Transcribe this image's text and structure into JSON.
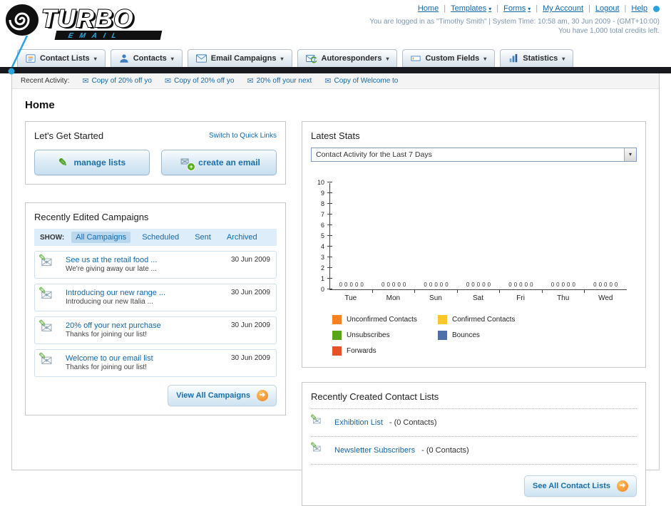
{
  "colors": {
    "accent_blue": "#2aa3dc",
    "link_blue": "#1468a8",
    "button_text_blue": "#1b6fa8",
    "orange_accent": "#f08018",
    "dark_bar": "#17191e"
  },
  "icons": {
    "chevron_down": "▾",
    "arrow_right": "➜",
    "envelope": "✉",
    "pencil": "✎",
    "plus": "+"
  },
  "header": {
    "logo_primary": "TURBO",
    "logo_secondary": "EMAIL",
    "separator": "|",
    "links": [
      {
        "label": "Home"
      },
      {
        "label": "Templates",
        "dropdown": true
      },
      {
        "label": "Forms",
        "dropdown": true
      },
      {
        "label": "My Account"
      },
      {
        "label": "Logout"
      },
      {
        "label": "Help"
      }
    ],
    "login_info": "You are logged in as \"Timothy Smith\" | System Time: 10:58 am, 30 Jun 2009 - (GMT+10:00)",
    "credits_info": "You have 1,000 total credits left."
  },
  "nav": {
    "items": [
      {
        "label": "Contact Lists"
      },
      {
        "label": "Contacts"
      },
      {
        "label": "Email Campaigns"
      },
      {
        "label": "Autoresponders"
      },
      {
        "label": "Custom Fields"
      },
      {
        "label": "Statistics"
      }
    ]
  },
  "recent_activity": {
    "label": "Recent Activity:",
    "items": [
      {
        "text": "Copy of 20% off yo"
      },
      {
        "text": "Copy of 20% off yo"
      },
      {
        "text": "20% off your next"
      },
      {
        "text": "Copy of Welcome to"
      }
    ]
  },
  "page": {
    "title": "Home"
  },
  "get_started": {
    "title": "Let's Get Started",
    "switch_link": "Switch to Quick Links",
    "manage_lists": "manage lists",
    "create_email": "create an email"
  },
  "campaigns": {
    "title": "Recently Edited Campaigns",
    "show_label": "SHOW:",
    "tabs": [
      {
        "label": "All Campaigns",
        "active": true
      },
      {
        "label": "Scheduled"
      },
      {
        "label": "Sent"
      },
      {
        "label": "Archived"
      }
    ],
    "items": [
      {
        "title": "See us at the retail food ...",
        "subtitle": "We're giving away our late ...",
        "date": "30 Jun 2009"
      },
      {
        "title": "Introducing our new range ...",
        "subtitle": "Introducing our new Italia ...",
        "date": "30 Jun 2009"
      },
      {
        "title": "20% off your next purchase",
        "subtitle": "Thanks for joining our list!",
        "date": "30 Jun 2009"
      },
      {
        "title": "Welcome to our email list",
        "subtitle": "Thanks for joining our list!",
        "date": "30 Jun 2009"
      }
    ],
    "view_all_button": "View All Campaigns"
  },
  "stats": {
    "title": "Latest Stats",
    "period_selector": "Contact Activity for the Last 7 Days"
  },
  "chart_data": {
    "type": "bar",
    "title": "Contact Activity for the Last 7 Days",
    "categories": [
      "Tue",
      "Mon",
      "Sun",
      "Sat",
      "Fri",
      "Thu",
      "Wed"
    ],
    "series": [
      {
        "name": "Unconfirmed Contacts",
        "color": "#f5821f",
        "values": [
          0,
          0,
          0,
          0,
          0,
          0,
          0
        ]
      },
      {
        "name": "Confirmed Contacts",
        "color": "#fdc62a",
        "values": [
          0,
          0,
          0,
          0,
          0,
          0,
          0
        ]
      },
      {
        "name": "Unsubscribes",
        "color": "#58a618",
        "values": [
          0,
          0,
          0,
          0,
          0,
          0,
          0
        ]
      },
      {
        "name": "Bounces",
        "color": "#4f6fa8",
        "values": [
          0,
          0,
          0,
          0,
          0,
          0,
          0
        ]
      },
      {
        "name": "Forwards",
        "color": "#e8502a",
        "values": [
          0,
          0,
          0,
          0,
          0,
          0,
          0
        ]
      }
    ],
    "ylim": [
      0,
      10
    ],
    "ytick_step": 1,
    "grid": false,
    "value_labels_shown": true,
    "legend_position": "bottom"
  },
  "contact_lists": {
    "title": "Recently Created Contact Lists",
    "items": [
      {
        "name": "Exhibition List",
        "detail": "- (0 Contacts)"
      },
      {
        "name": "Newsletter Subscribers",
        "detail": "- (0 Contacts)"
      }
    ],
    "see_all_button": "See All Contact Lists"
  }
}
